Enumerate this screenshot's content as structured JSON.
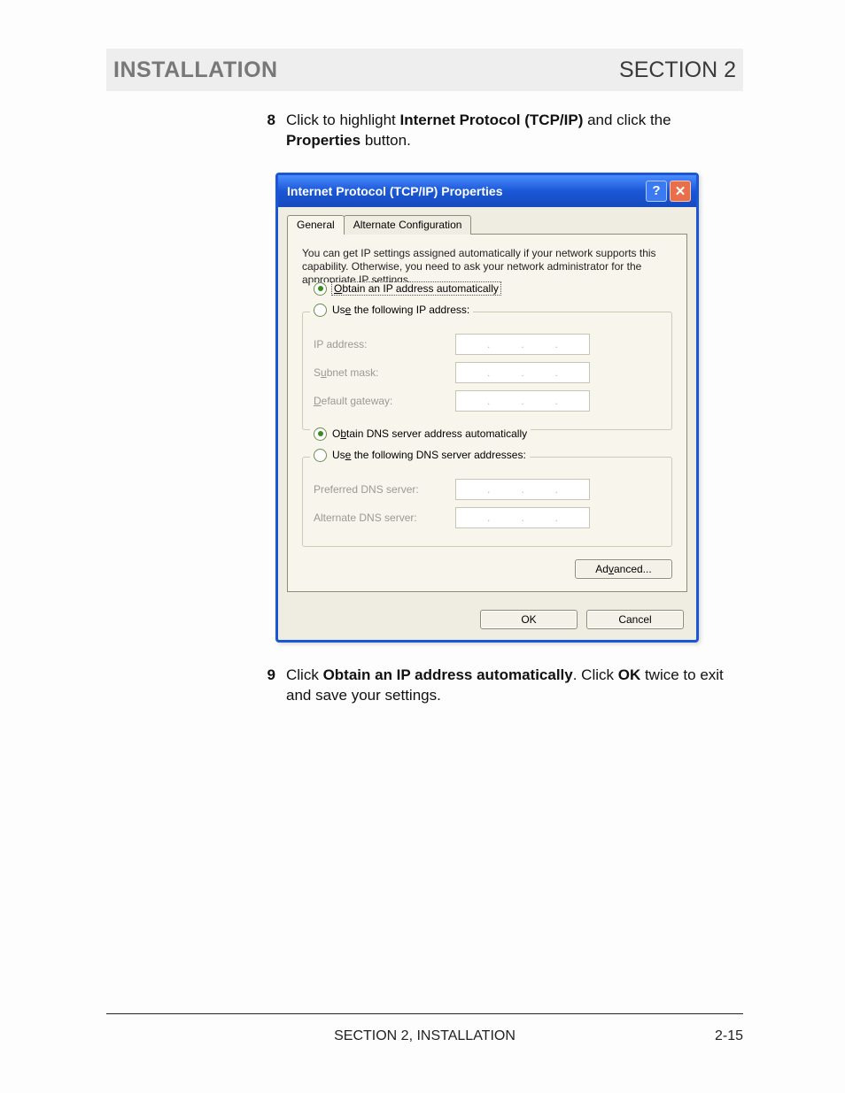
{
  "header": {
    "left": "INSTALLATION",
    "right": "SECTION 2"
  },
  "steps": {
    "s8": {
      "num": "8",
      "pre": "Click to highlight ",
      "bold1": "Internet Protocol (TCP/IP)",
      "mid": " and click the ",
      "bold2": "Properties",
      "post": " button."
    },
    "s9": {
      "num": "9",
      "pre": "Click ",
      "bold1": "Obtain an IP address automatically",
      "mid": ". Click ",
      "bold2": "OK",
      "post": " twice to exit and save your settings."
    }
  },
  "dialog": {
    "title": "Internet Protocol (TCP/IP) Properties",
    "help_glyph": "?",
    "close_glyph": "✕",
    "tabs": {
      "general": "General",
      "alt": "Alternate Configuration"
    },
    "description": "You can get IP settings assigned automatically if your network supports this capability. Otherwise, you need to ask your network administrator for the appropriate IP settings.",
    "ip": {
      "auto_pre": "O",
      "auto_rest": "btain an IP address automatically",
      "manual_pre": "Us",
      "manual_u": "e",
      "manual_rest": " the following IP address:",
      "ip_lbl": "IP address:",
      "subnet_lbl_pre": "S",
      "subnet_lbl_u": "u",
      "subnet_lbl_rest": "bnet mask:",
      "gw_lbl_pre": "",
      "gw_lbl_u": "D",
      "gw_lbl_rest": "efault gateway:"
    },
    "dns": {
      "auto_pre": "O",
      "auto_u": "b",
      "auto_rest": "tain DNS server address automatically",
      "manual_pre": "Us",
      "manual_u": "e",
      "manual_rest": " the following DNS server addresses:",
      "pref_lbl": "Preferred DNS server:",
      "alt_lbl": "Alternate DNS server:"
    },
    "advanced_pre": "Ad",
    "advanced_u": "v",
    "advanced_rest": "anced...",
    "ok": "OK",
    "cancel": "Cancel",
    "dots": "."
  },
  "footer": {
    "center": "SECTION 2, INSTALLATION",
    "right": "2-15"
  }
}
